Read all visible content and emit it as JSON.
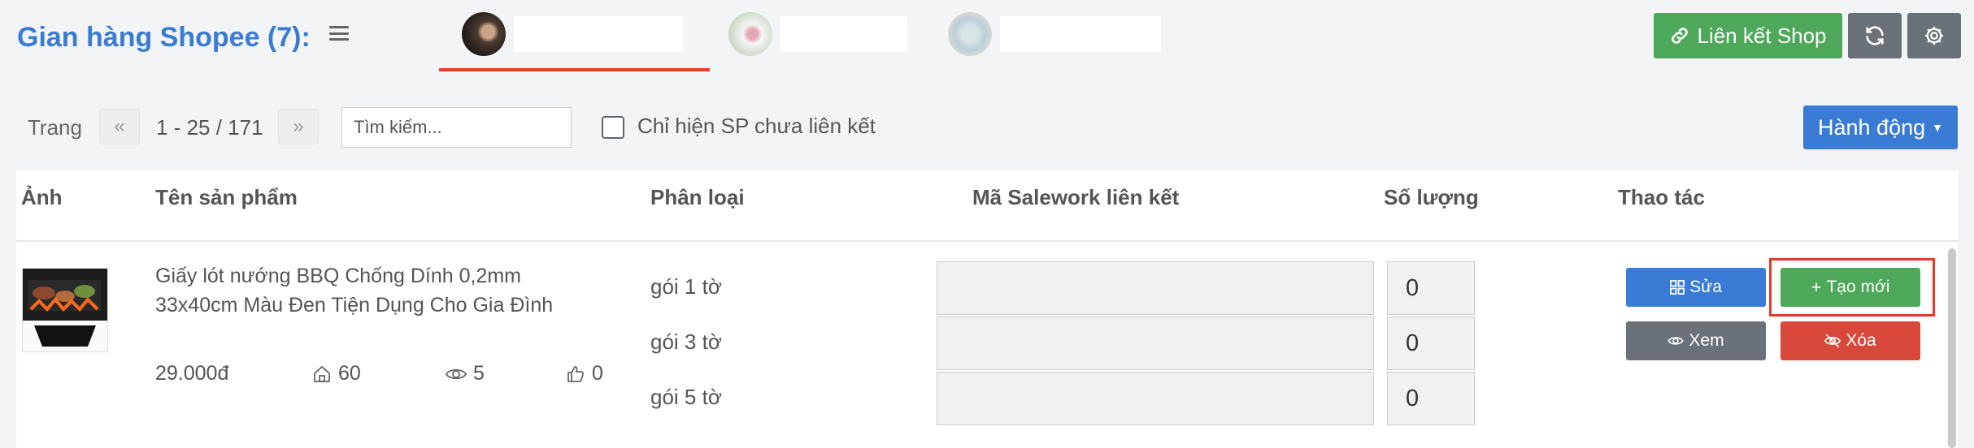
{
  "header": {
    "title": "Gian hàng Shopee (7):",
    "link_shop_label": "Liên kết Shop"
  },
  "toolbar": {
    "page_label": "Trang",
    "page_range": "1 - 25 / 171",
    "search_placeholder": "Tìm kiếm...",
    "checkbox_label": "Chỉ hiện SP chưa liên kết",
    "action_label": "Hành động"
  },
  "table": {
    "headers": {
      "image": "Ảnh",
      "name": "Tên sản phẩm",
      "variant": "Phân loại",
      "sku": "Mã Salework liên kết",
      "qty": "Số lượng",
      "actions": "Thao tác"
    },
    "rows": [
      {
        "name": "Giấy lót nướng BBQ Chống Dính 0,2mm 33x40cm Màu Đen Tiện Dụng Cho Gia Đình",
        "price": "29.000đ",
        "stock": "60",
        "views": "5",
        "likes": "0",
        "variants": [
          {
            "label": "gói 1 tờ",
            "sku": "",
            "qty": "0"
          },
          {
            "label": "gói 3 tờ",
            "sku": "",
            "qty": "0"
          },
          {
            "label": "gói 5 tờ",
            "sku": "",
            "qty": "0"
          }
        ],
        "buttons": {
          "edit": "Sửa",
          "create": "Tạo mới",
          "view": "Xem",
          "delete": "Xóa"
        }
      }
    ]
  },
  "colors": {
    "accent_blue": "#3a7bd5",
    "green": "#4ea85a",
    "gray": "#6b7178",
    "red": "#d9493b",
    "highlight": "#e23c2a"
  },
  "icons": [
    "menu-icon",
    "link-icon",
    "refresh-icon",
    "gear-icon",
    "chevron-double-left-icon",
    "chevron-double-right-icon",
    "caret-down-icon",
    "store-icon",
    "eye-icon",
    "thumbs-up-icon",
    "grid-icon",
    "plus-icon",
    "eye-off-icon"
  ]
}
